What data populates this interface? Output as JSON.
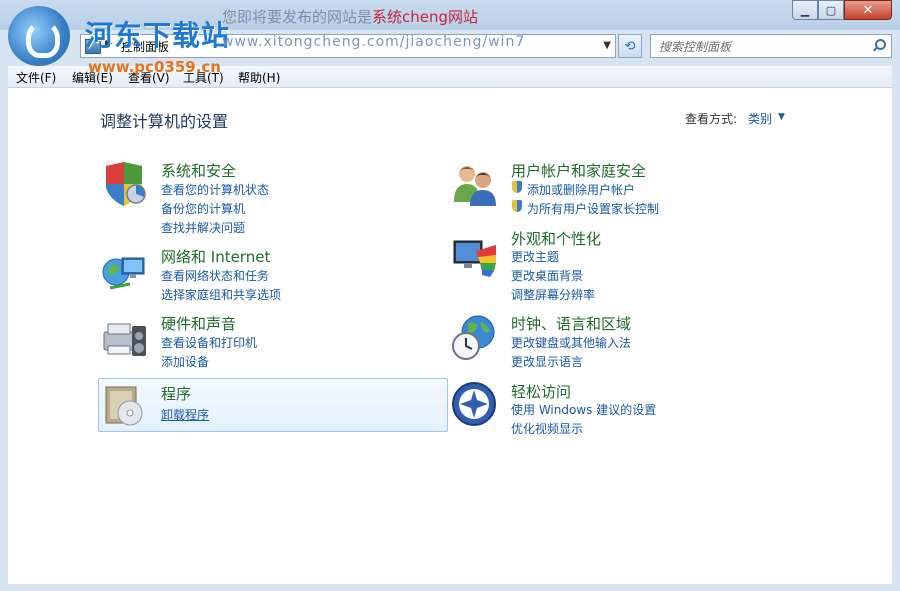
{
  "watermark": {
    "site_name": "河东下载站",
    "site_url": "www.pc0359.cn",
    "banner_text": "您即将要发布的网站是",
    "banner_highlight": "系统cheng网站",
    "banner_url": "www.xitongcheng.com/jiaocheng/win7"
  },
  "window_controls": {
    "minimize": "▁",
    "maximize": "▢",
    "close": "✕"
  },
  "address_bar": {
    "path": "控制面板"
  },
  "search": {
    "placeholder": "搜索控制面板"
  },
  "menu": [
    "文件(F)",
    "编辑(E)",
    "查看(V)",
    "工具(T)",
    "帮助(H)"
  ],
  "page": {
    "heading": "调整计算机的设置",
    "view_by_label": "查看方式:",
    "view_by_value": "类别"
  },
  "categories": [
    {
      "title": "系统和安全",
      "icon": "system-security-icon",
      "links": [
        "查看您的计算机状态",
        "备份您的计算机",
        "查找并解决问题"
      ]
    },
    {
      "title": "网络和 Internet",
      "icon": "network-icon",
      "links": [
        "查看网络状态和任务",
        "选择家庭组和共享选项"
      ]
    },
    {
      "title": "硬件和声音",
      "icon": "hardware-sound-icon",
      "links": [
        "查看设备和打印机",
        "添加设备"
      ]
    },
    {
      "title": "程序",
      "icon": "programs-icon",
      "links": [
        "卸载程序"
      ]
    },
    {
      "title": "用户帐户和家庭安全",
      "icon": "user-accounts-icon",
      "links": [
        "添加或删除用户帐户",
        "为所有用户设置家长控制"
      ]
    },
    {
      "title": "外观和个性化",
      "icon": "appearance-icon",
      "links": [
        "更改主题",
        "更改桌面背景",
        "调整屏幕分辨率"
      ]
    },
    {
      "title": "时钟、语言和区域",
      "icon": "clock-region-icon",
      "links": [
        "更改键盘或其他输入法",
        "更改显示语言"
      ]
    },
    {
      "title": "轻松访问",
      "icon": "ease-of-access-icon",
      "links": [
        "使用 Windows 建议的设置",
        "优化视频显示"
      ]
    }
  ]
}
